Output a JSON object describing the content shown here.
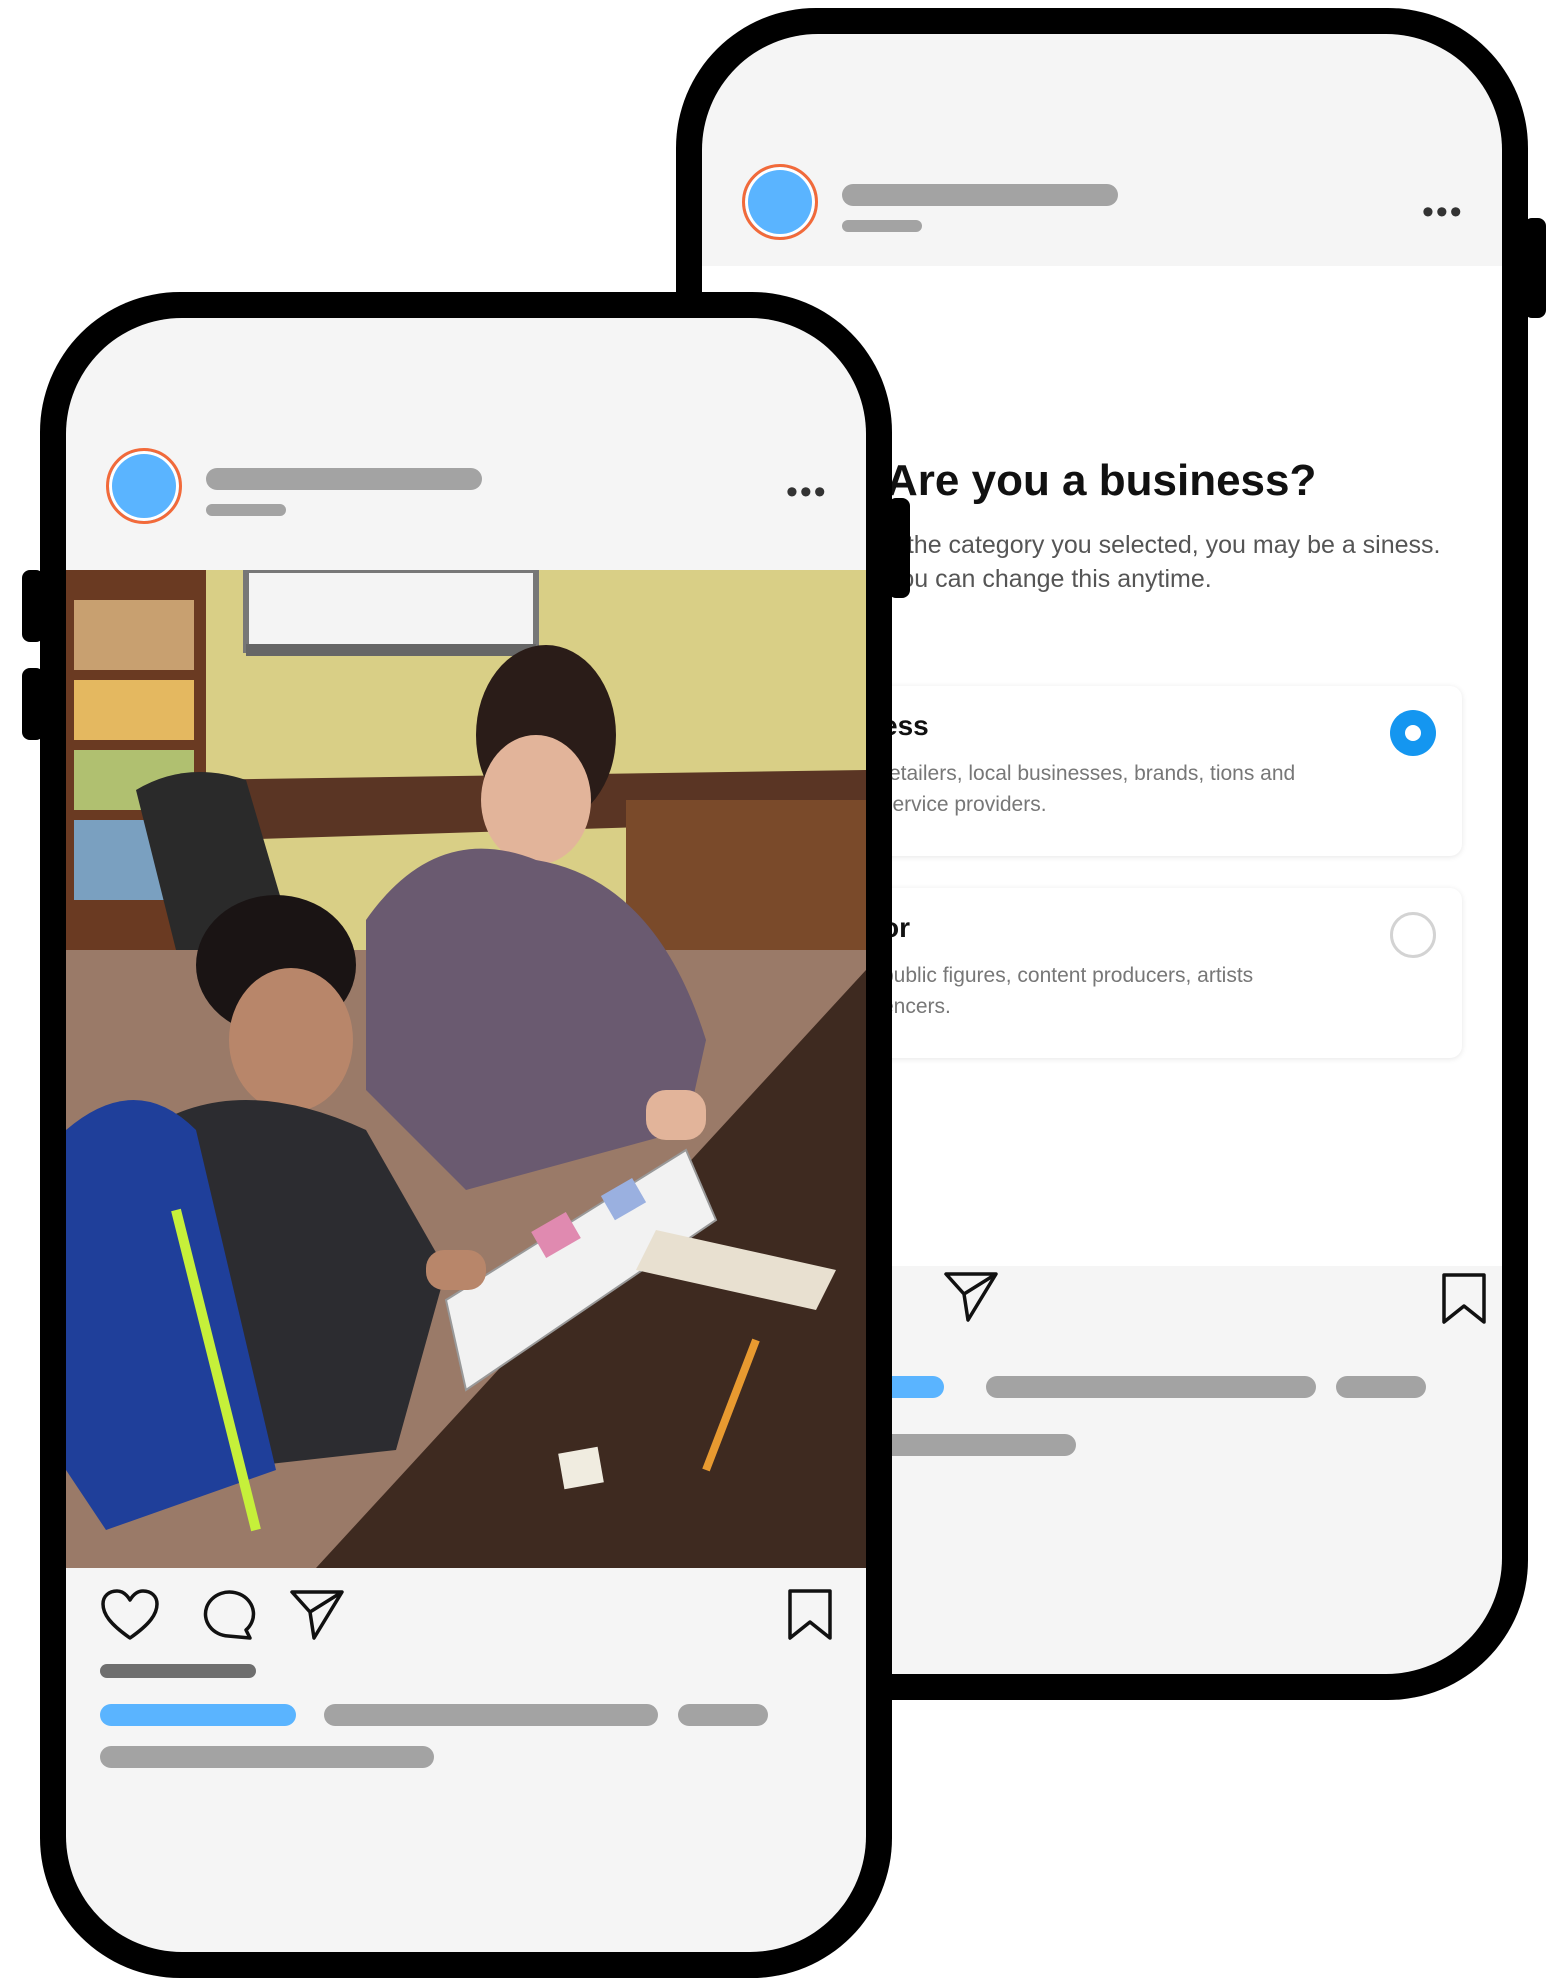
{
  "back_post": {
    "more_label": "•••",
    "business_prompt": {
      "title": "Are you a business?",
      "subtitle": "n the category you selected, you may be a siness. You can change this anytime."
    },
    "options": [
      {
        "title": "ess",
        "description": "retailers, local businesses, brands, tions and service providers.",
        "selected": true
      },
      {
        "title": "or",
        "description": "public figures, content producers, artists encers.",
        "selected": false
      }
    ],
    "icons": [
      "send-icon",
      "bookmark-icon"
    ]
  },
  "front_post": {
    "more_label": "•••",
    "photo": "teacher-and-boy-reading-book-photo",
    "icons": [
      "heart-icon",
      "comment-icon",
      "send-icon",
      "bookmark-icon"
    ]
  },
  "colors": {
    "avatar_fill": "#5ab4ff",
    "avatar_ring": "#f26a3a",
    "placeholder_bar": "#a3a3a3",
    "accent_bar": "#5ab4ff",
    "radio_selected": "#1496f0",
    "phone_frame": "#000000",
    "screen_bg": "#f5f5f5"
  }
}
